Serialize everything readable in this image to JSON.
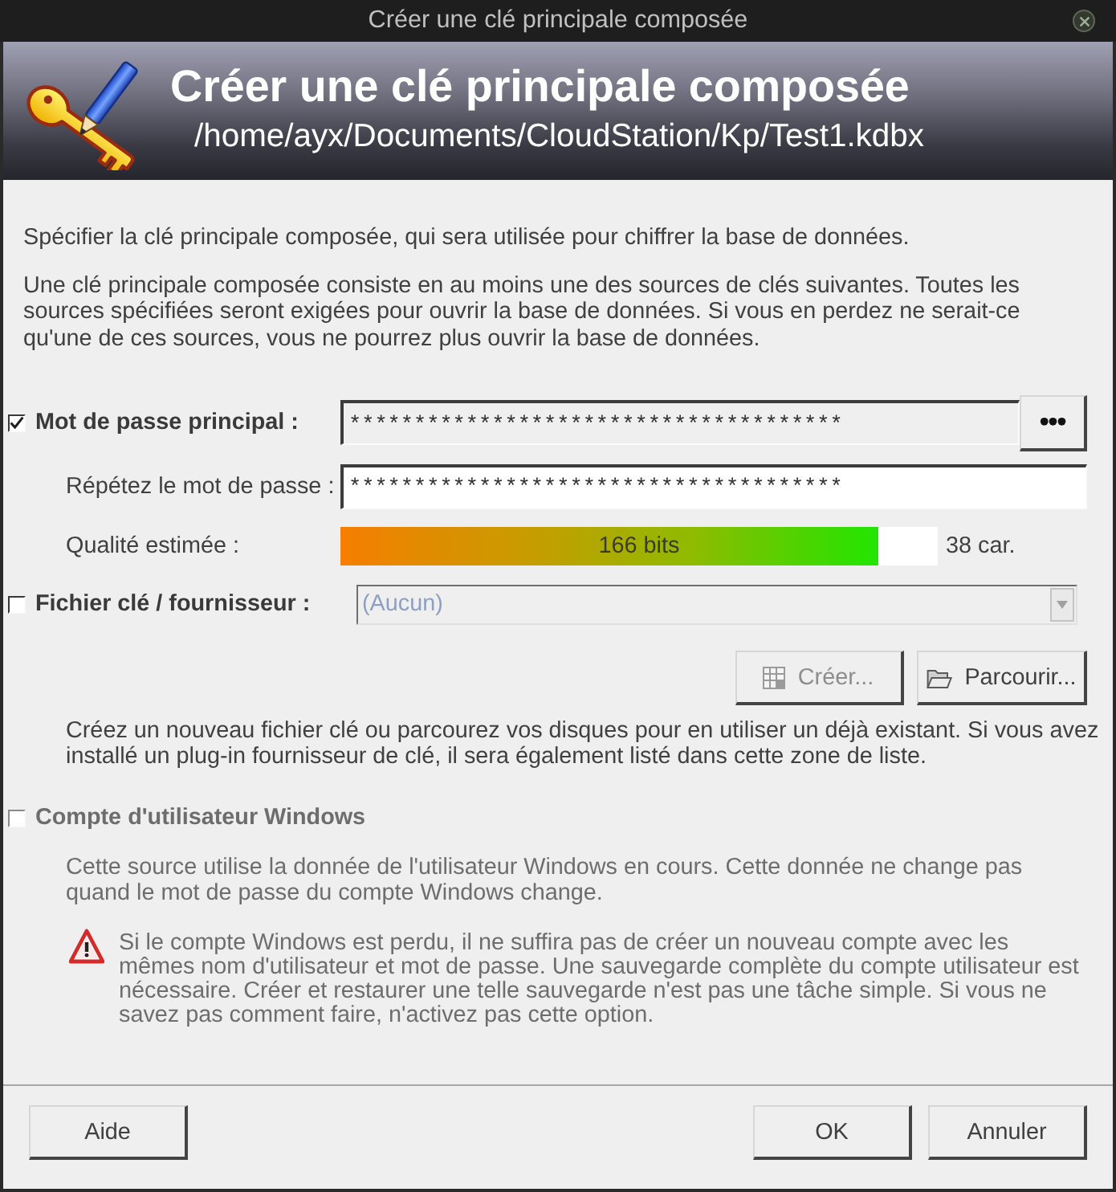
{
  "window": {
    "title": "Créer une clé principale composée"
  },
  "header": {
    "title": "Créer une clé principale composée",
    "path": "/home/ayx/Documents/CloudStation/Kp/Test1.kdbx"
  },
  "intro": [
    "Spécifier la clé principale composée, qui sera utilisée pour chiffrer la base de données.",
    "Une clé principale composée consiste en au moins une des sources de clés suivantes. Toutes les sources spécifiées seront exigées pour ouvrir la base de données. Si vous en perdez ne serait-ce qu'une de ces sources, vous ne pourrez plus ouvrir la base de données."
  ],
  "master_password": {
    "checked": true,
    "label": "Mot de passe principal :",
    "value": "**************************************",
    "reveal_button": "•••",
    "repeat_label": "Répétez le mot de passe :",
    "repeat_value": "**************************************",
    "quality_label": "Qualité estimée :",
    "quality": {
      "level": 0.9,
      "bits": "166 bits",
      "length": "38 car."
    }
  },
  "key_file": {
    "checked": false,
    "label": "Fichier clé / fournisseur :",
    "selection": {
      "value": "(Aucun)",
      "disabled": true
    },
    "buttons": [
      {
        "label": "Créer...",
        "disabled": true
      },
      {
        "label": "Parcourir...",
        "disabled": false
      }
    ],
    "help": "Créez un nouveau fichier clé ou parcourez vos disques pour en utiliser un déjà existant. Si vous avez installé un plug-in fournisseur de clé, il sera également listé dans cette zone de liste."
  },
  "windows_account": {
    "checked": false,
    "disabled": true,
    "label": "Compte d'utilisateur Windows",
    "description": "Cette source utilise la donnée de l'utilisateur Windows en cours. Cette donnée ne change pas quand le mot de passe du compte Windows change.",
    "warning": "Si le compte Windows est perdu, il ne suffira pas de créer un nouveau compte avec les mêmes nom d'utilisateur et mot de passe. Une sauvegarde complète du compte utilisateur est nécessaire. Créer et restaurer une telle sauvegarde n'est pas une tâche simple. Si vous ne savez pas comment faire, n'activez pas cette option."
  },
  "footer": {
    "help_button": "Aide",
    "buttons": [
      "OK",
      "Annuler"
    ]
  }
}
